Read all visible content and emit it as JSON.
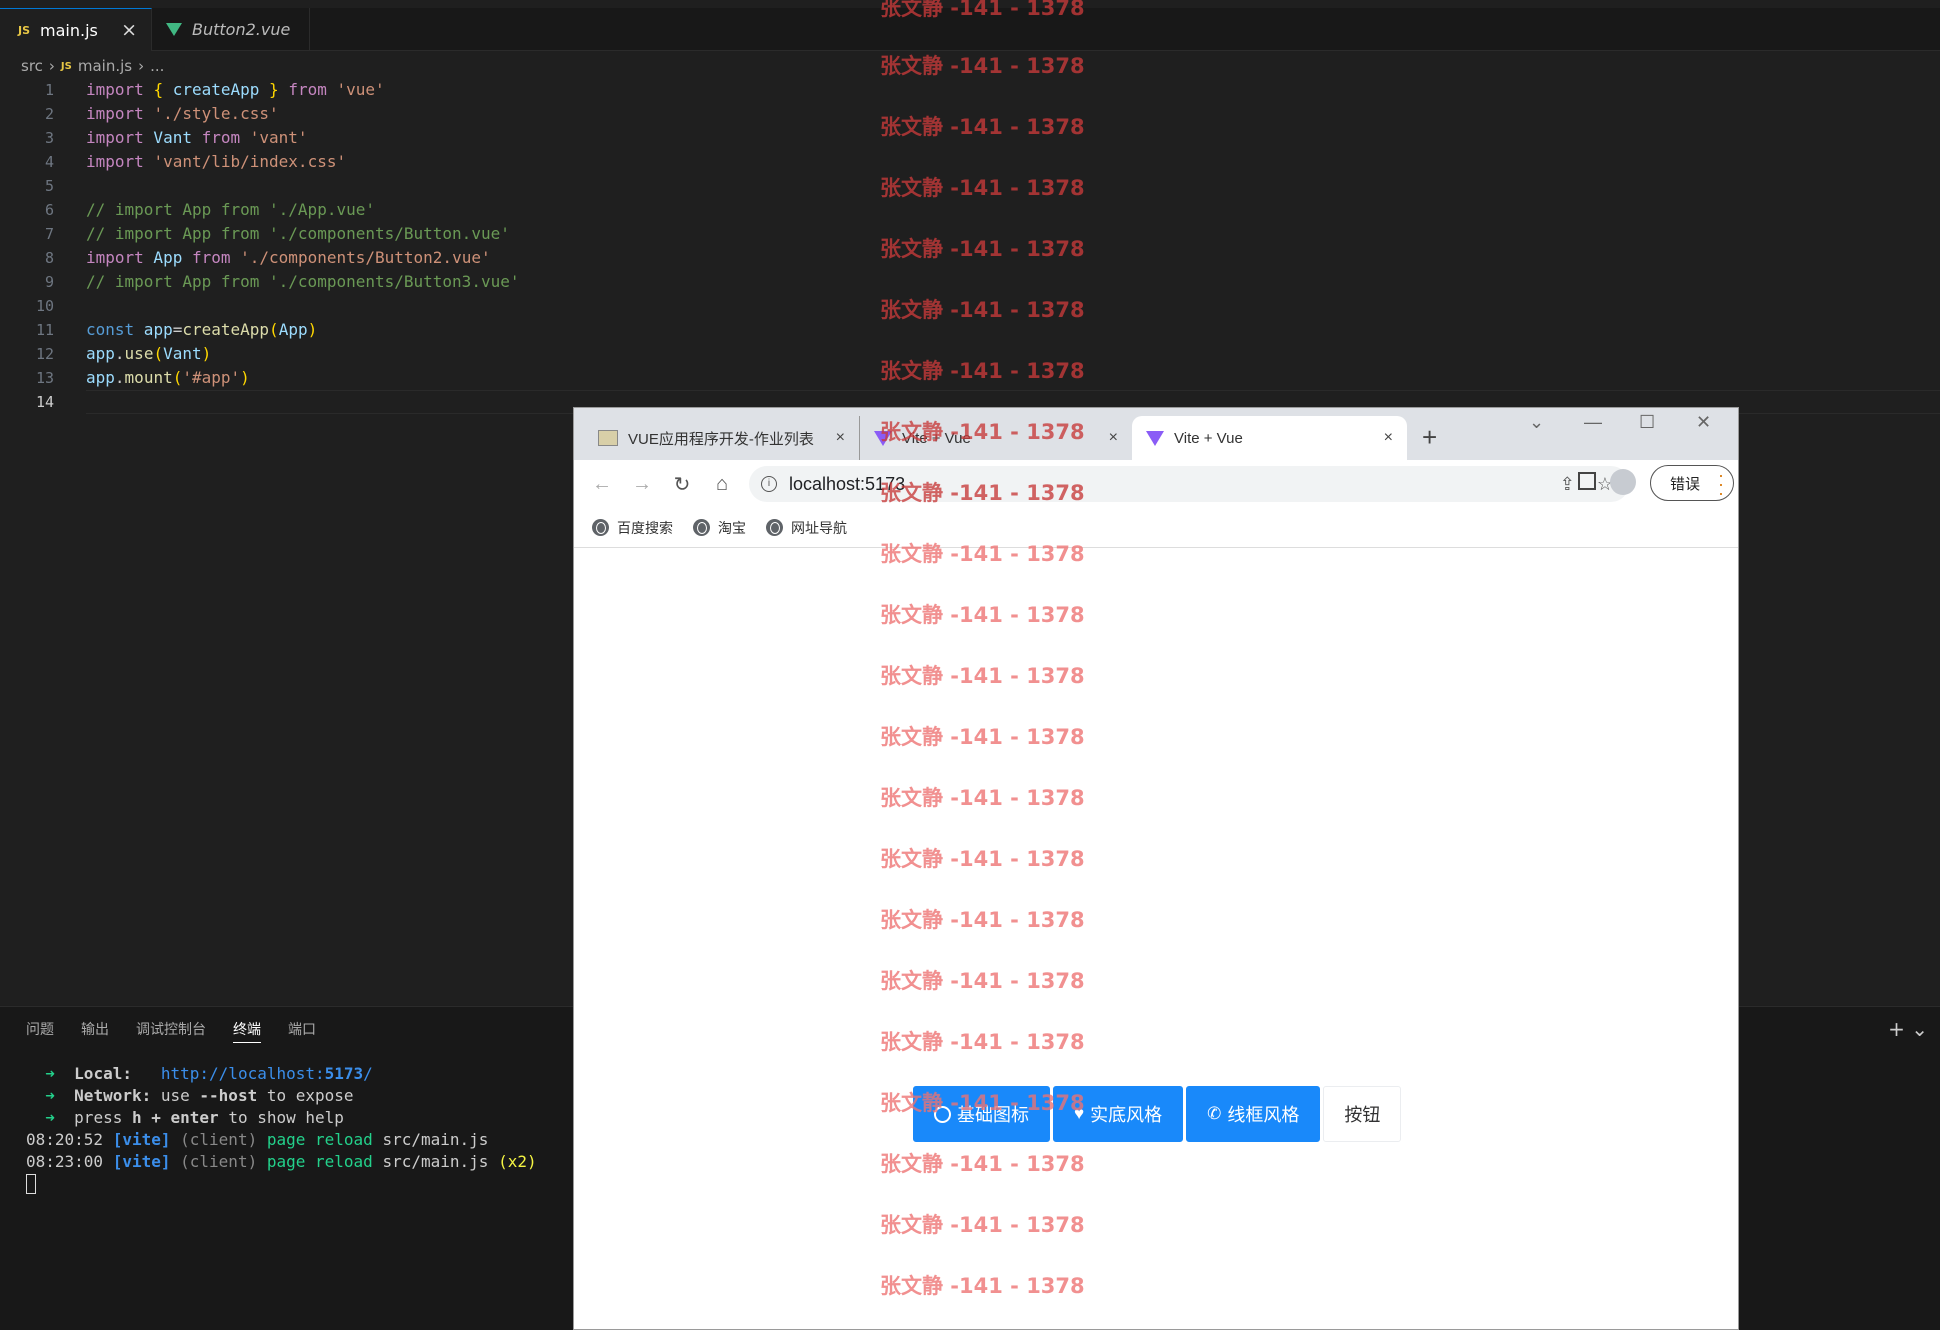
{
  "editor": {
    "tabs": [
      {
        "icon": "js-icon",
        "label": "main.js",
        "active": true
      },
      {
        "icon": "vue-icon",
        "label": "Button2.vue",
        "active": false
      }
    ],
    "breadcrumb": {
      "folder": "src",
      "file": "main.js",
      "more": "..."
    },
    "current_line": "14",
    "lines": [
      {
        "n": "1"
      },
      {
        "n": "2"
      },
      {
        "n": "3"
      },
      {
        "n": "4"
      },
      {
        "n": "5"
      },
      {
        "n": "6"
      },
      {
        "n": "7"
      },
      {
        "n": "8"
      },
      {
        "n": "9"
      },
      {
        "n": "10"
      },
      {
        "n": "11"
      },
      {
        "n": "12"
      },
      {
        "n": "13"
      },
      {
        "n": "14"
      }
    ],
    "code": {
      "l1": [
        "import",
        " ",
        "{",
        " createApp ",
        "}",
        " from ",
        "'vue'"
      ],
      "l2": [
        "import",
        " ",
        "'./style.css'"
      ],
      "l3": [
        "import",
        " Vant ",
        "from",
        " ",
        "'vant'"
      ],
      "l4": [
        "import",
        " ",
        "'vant/lib/index.css'"
      ],
      "l6": "// import App from './App.vue'",
      "l7": "// import App from './components/Button.vue'",
      "l8": [
        "import",
        " App ",
        "from",
        " ",
        "'./components/Button2.vue'"
      ],
      "l9": "// import App from './components/Button3.vue'",
      "l11": [
        "const",
        " app",
        "=",
        "createApp",
        "(",
        "App",
        ")"
      ],
      "l12": [
        "app",
        ".",
        "use",
        "(",
        "Vant",
        ")"
      ],
      "l13": [
        "app",
        ".",
        "mount",
        "(",
        "'#app'",
        ")"
      ]
    }
  },
  "panel": {
    "tabs": [
      "问题",
      "输出",
      "调试控制台",
      "终端",
      "端口"
    ],
    "active_tab": "终端",
    "add_label": "+ ⌄",
    "terminal": {
      "local_label": "Local:",
      "local_url_pre": "http://localhost:",
      "local_url_port": "5173",
      "local_url_post": "/",
      "network_label": "Network:",
      "network_text": " use ",
      "network_flag": "--host",
      "network_tail": " to expose",
      "help_pre": "press ",
      "help_h": "h",
      "help_plus": " + ",
      "help_enter": "enter",
      "help_post": " to show help",
      "log1_time": "08:20:52",
      "log1_tag": "[vite]",
      "log1_client": "(client)",
      "log1_msg": "page reload",
      "log1_file": "src/main.js",
      "log2_time": "08:23:00",
      "log2_tag": "[vite]",
      "log2_client": "(client)",
      "log2_msg": "page reload",
      "log2_file": "src/main.js",
      "log2_count": "(x2)",
      "arrow": "➜"
    }
  },
  "browser": {
    "tabs": [
      {
        "label": "VUE应用程序开发-作业列表",
        "close": "×"
      },
      {
        "label": "Vite + Vue",
        "close": "×"
      },
      {
        "label": "Vite + Vue",
        "close": "×",
        "active": true
      }
    ],
    "new_tab": "+",
    "window_controls": {
      "dropdown": "⌄",
      "minimize": "—",
      "maximize": "☐",
      "close": "✕"
    },
    "url": "localhost:5173",
    "error_button": "错误",
    "bookmarks": [
      "百度搜索",
      "淘宝",
      "网址导航"
    ],
    "buttons": [
      {
        "label": "基础图标",
        "icon": "circle-icon"
      },
      {
        "label": "实底风格",
        "icon": "heart-icon"
      },
      {
        "label": "线框风格",
        "icon": "phone-icon"
      },
      {
        "label": "按钮",
        "icon": ""
      }
    ]
  },
  "watermark": {
    "text": "张文静 -141 - 1378"
  }
}
